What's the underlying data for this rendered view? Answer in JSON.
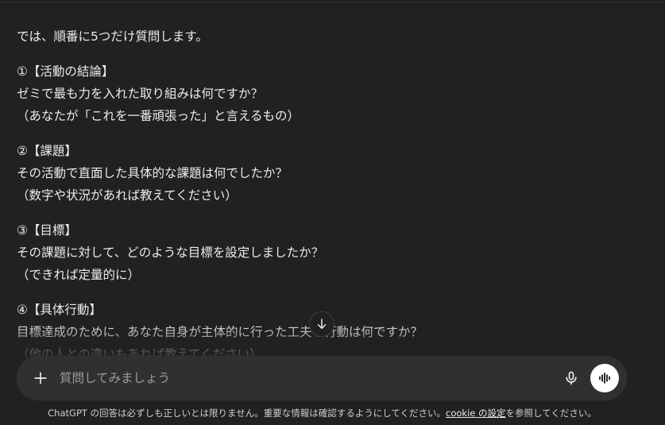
{
  "message": {
    "intro": "では、順番に5つだけ質問します。",
    "sections": [
      {
        "heading": "①【活動の結論】",
        "question": "ゼミで最も力を入れた取り組みは何ですか？",
        "note": "（あなたが「これを一番頑張った」と言えるもの）"
      },
      {
        "heading": "②【課題】",
        "question": "その活動で直面した具体的な課題は何でしたか？",
        "note": "（数字や状況があれば教えてください）"
      },
      {
        "heading": "③【目標】",
        "question": "その課題に対して、どのような目標を設定しましたか？",
        "note": "（できれば定量的に）"
      },
      {
        "heading": "④【具体行動】",
        "question": "目標達成のために、あなた自身が主体的に行った工夫や行動は何ですか？",
        "note": "（他の人との違いもあれば教えてください）"
      }
    ]
  },
  "composer": {
    "placeholder": "質問してみましょう",
    "icons": {
      "add": "plus-icon",
      "mic": "microphone-icon",
      "voice": "voice-mode-icon",
      "scroll": "arrow-down-icon"
    }
  },
  "footer": {
    "disclaimer_prefix": "ChatGPT の回答は必ずしも正しいとは限りません。重要な情報は確認するようにしてください。",
    "cookie_link": "cookie の設定",
    "disclaimer_suffix": "を参照してください。"
  }
}
